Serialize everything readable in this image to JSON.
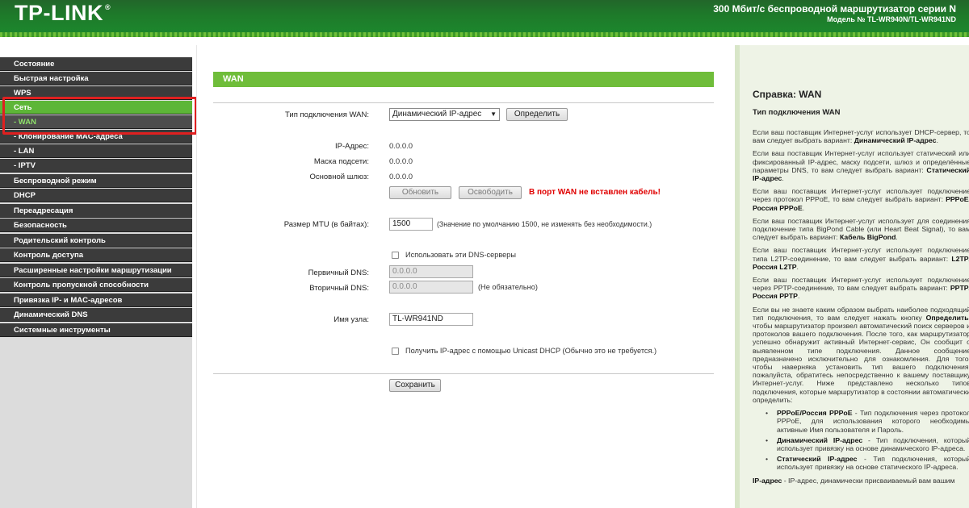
{
  "header": {
    "logo": "TP-LINK",
    "logo_tm": "®",
    "title": "300 Мбит/с беспроводной маршрутизатор серии N",
    "model": "Модель № TL-WR940N/TL-WR941ND"
  },
  "sidebar": {
    "items": [
      {
        "label": "Состояние"
      },
      {
        "label": "Быстрая настройка"
      },
      {
        "label": "WPS"
      },
      {
        "label": "Сеть"
      },
      {
        "label": "- WAN"
      },
      {
        "label": "- Клонирование MAC-адреса"
      },
      {
        "label": "- LAN"
      },
      {
        "label": "- IPTV"
      },
      {
        "label": "Беспроводной режим"
      },
      {
        "label": "DHCP"
      },
      {
        "label": "Переадресация"
      },
      {
        "label": "Безопасность"
      },
      {
        "label": "Родительский контроль"
      },
      {
        "label": "Контроль доступа"
      },
      {
        "label": "Расширенные настройки маршрутизации"
      },
      {
        "label": "Контроль пропускной способности"
      },
      {
        "label": "Привязка IP- и MAC-адресов"
      },
      {
        "label": "Динамический DNS"
      },
      {
        "label": "Системные инструменты"
      }
    ]
  },
  "main": {
    "section_title": "WAN",
    "wan_type_label": "Тип подключения WAN:",
    "wan_type_value": "Динамический IP-адрес",
    "detect_button": "Определить",
    "ip_label": "IP-Адрес:",
    "ip_value": "0.0.0.0",
    "mask_label": "Маска подсети:",
    "mask_value": "0.0.0.0",
    "gateway_label": "Основной шлюз:",
    "gateway_value": "0.0.0.0",
    "renew_button": "Обновить",
    "release_button": "Освободить",
    "warning": "В порт WAN не вставлен кабель!",
    "mtu_label": "Размер MTU (в байтах):",
    "mtu_value": "1500",
    "mtu_hint": "(Значение по умолчанию 1500, не изменять без необходимости.)",
    "use_dns_label": "Использовать эти DNS-серверы",
    "primary_dns_label": "Первичный DNS:",
    "primary_dns_value": "0.0.0.0",
    "secondary_dns_label": "Вторичный DNS:",
    "secondary_dns_value": "0.0.0.0",
    "secondary_dns_hint": "(Не обязательно)",
    "hostname_label": "Имя узла:",
    "hostname_value": "TL-WR941ND",
    "unicast_label": "Получить IP-адрес с помощью Unicast DHCP (Обычно это не требуется.)",
    "save_button": "Сохранить"
  },
  "help": {
    "title": "Справка: WAN",
    "subtitle": "Тип подключения WAN",
    "p1": "Если ваш поставщик Интернет-услуг использует DHCP-сервер, то вам следует выбрать вариант: ",
    "p1_b": "Динамический IP-адрес",
    "p2": "Если ваш поставщик Интернет-услуг использует статический или фиксированный IP-адрес, маску подсети, шлюз и определённые параметры DNS, то вам следует выбрать вариант: ",
    "p2_b": "Статический IP-адрес",
    "p3": "Если ваш поставщик Интернет-услуг использует подключение через протокол PPPoE, то вам следует выбрать вариант: ",
    "p3_b": "PPPoE/Россия PPPoE",
    "p4": "Если ваш поставщик Интернет-услуг использует для соединения подключение типа BigPond Cable (или Heart Beat Signal), то вам следует выбрать вариант: ",
    "p4_b": "Кабель BigPond",
    "p5": "Если ваш поставщик Интернет-услуг использует подключение типа L2TP-соединение, то вам следует выбрать вариант: ",
    "p5_b": "L2TP/Россия L2TP",
    "p6": "Если ваш поставщик Интернет-услуг использует подключение через PPTP-соединение, то вам следует выбрать вариант: ",
    "p6_b": "PPTP/Россия PPTP",
    "p7a": "Если вы не знаете каким образом выбрать наиболее подходящий тип подключения, то вам следует нажать кнопку ",
    "p7_b": "Определить",
    "p7b": ", чтобы маршрутизатор произвел автоматический поиск серверов и протоколов вашего подключения. После того, как маршрутизатор успешно обнаружит активный Интернет-сервис, Он сообщит о выявленном типе подключения. Данное сообщение предназначено исключительно для ознакомления. Для того, чтобы наверняка установить тип вашего подключения, пожалуйста, обратитесь непосредственно к вашему поставщику Интернет-услуг. Ниже представлено несколько типов подключения, которые маршрутизатор в состоянии автоматически определить:",
    "li1_b": "PPPoE/Россия PPPoE",
    "li1": " - Тип подключения через протокол PPPoE, для использования которого необходимы активные Имя пользователя и Пароль.",
    "li2_b": "Динамический IP-адрес",
    "li2": " - Тип подключения, который использует привязку на основе динамического IP-адреса.",
    "li3_b": "Статический IP-адрес",
    "li3": " - Тип подключения, который использует привязку на основе статического IP-адреса.",
    "p8_b": "IP-адрес",
    "p8": " - IP-адрес, динамически присваиваемый вам вашим"
  }
}
